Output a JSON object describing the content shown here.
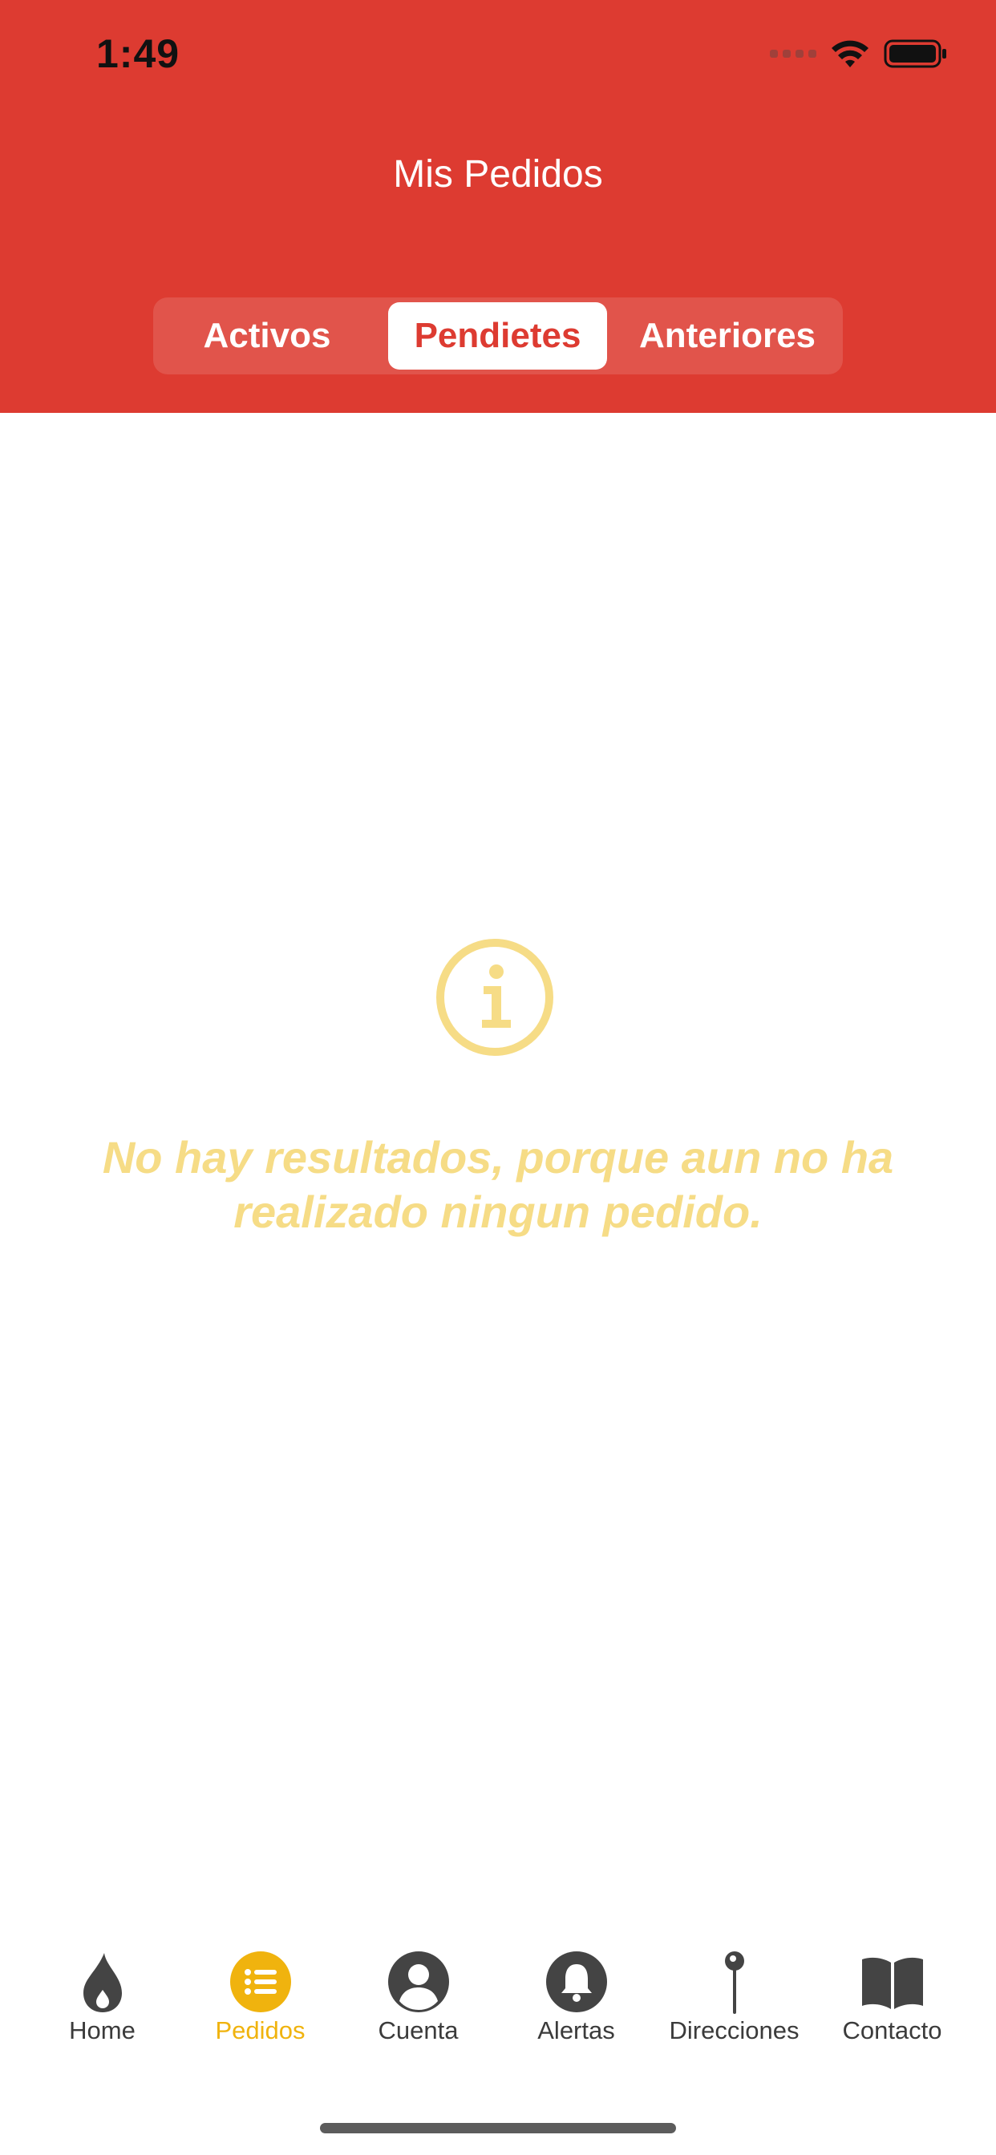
{
  "status_bar": {
    "time": "1:49"
  },
  "header": {
    "title": "Mis Pedidos",
    "background_color": "#dd3b31"
  },
  "segments": {
    "items": [
      {
        "label": "Activos",
        "selected": false
      },
      {
        "label": "Pendietes",
        "selected": true
      },
      {
        "label": "Anteriores",
        "selected": false
      }
    ]
  },
  "empty_state": {
    "icon": "info-circle-icon",
    "message": "No hay resultados, porque aun no ha realizado ningun pedido.",
    "color": "#f6dc86"
  },
  "tabbar": {
    "active_color": "#f0b30e",
    "inactive_color": "#3b3b3b",
    "items": [
      {
        "label": "Home",
        "icon": "flame-icon",
        "active": false
      },
      {
        "label": "Pedidos",
        "icon": "list-icon",
        "active": true
      },
      {
        "label": "Cuenta",
        "icon": "user-icon",
        "active": false
      },
      {
        "label": "Alertas",
        "icon": "bell-icon",
        "active": false
      },
      {
        "label": "Direcciones",
        "icon": "pin-icon",
        "active": false
      },
      {
        "label": "Contacto",
        "icon": "book-icon",
        "active": false
      }
    ]
  }
}
